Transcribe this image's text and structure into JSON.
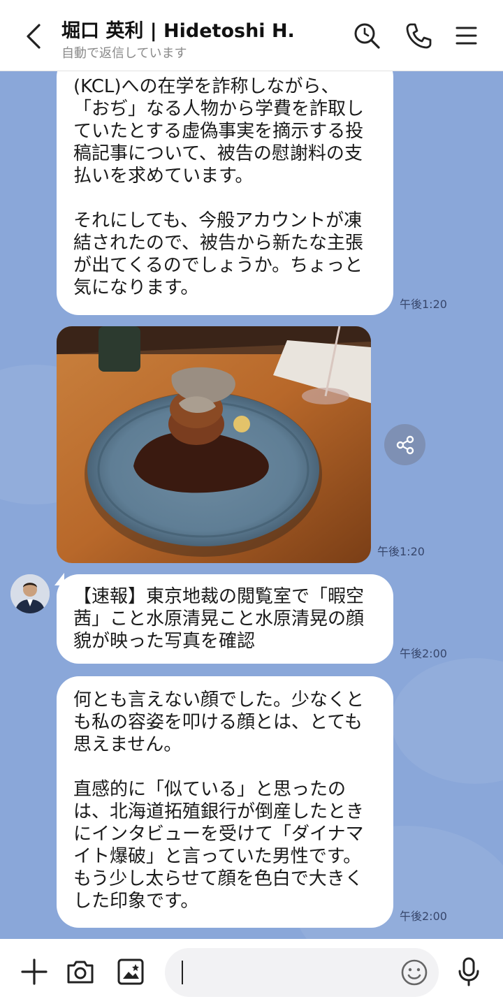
{
  "header": {
    "title": "堀口 英利 | Hidetoshi H.",
    "subtitle": "自動で返信しています",
    "icons": [
      "back-icon",
      "search-icon",
      "phone-icon",
      "menu-icon"
    ]
  },
  "messages": [
    {
      "text": "(KCL)への在学を詐称しながら、\n「おぢ」なる人物から学費を詐取し\nていたとする虚偽事実を摘示する投\n稿記事について、被告の慰謝料の支\n払いを求めています。\n\nそれにしても、今般アカウントが凍\n結されたので、被告から新たな主張\nが出てくるのでしょうか。ちょっと\n気になります。",
      "time": "午後1:20"
    },
    {
      "type": "photo",
      "description_icon": "photo-dish",
      "time": "午後1:20"
    },
    {
      "text": "【速報】東京地裁の閲覧室で「暇空\n茜」こと水原清晃こと水原清晃の顔\n貌が映った写真を確認",
      "time": "午後2:00"
    },
    {
      "text": "何とも言えない顔でした。少なくと\nも私の容姿を叩ける顔とは、とても\n思えません。\n\n直感的に「似ている」と思ったの\nは、北海道拓殖銀行が倒産したとき\nにインタビューを受けて「ダイナマ\nイト爆破」と言っていた男性です。\nもう少し太らせて顔を色白で大きく\nした印象です。",
      "time": "午後2:00"
    }
  ],
  "footer": {
    "input_value": "",
    "icons": [
      "plus-icon",
      "camera-icon",
      "image-icon",
      "emoji-icon",
      "microphone-icon"
    ]
  },
  "colors": {
    "chat_background": "#8aa7d9",
    "bubble": "#ffffff",
    "time_text": "#37466b"
  }
}
